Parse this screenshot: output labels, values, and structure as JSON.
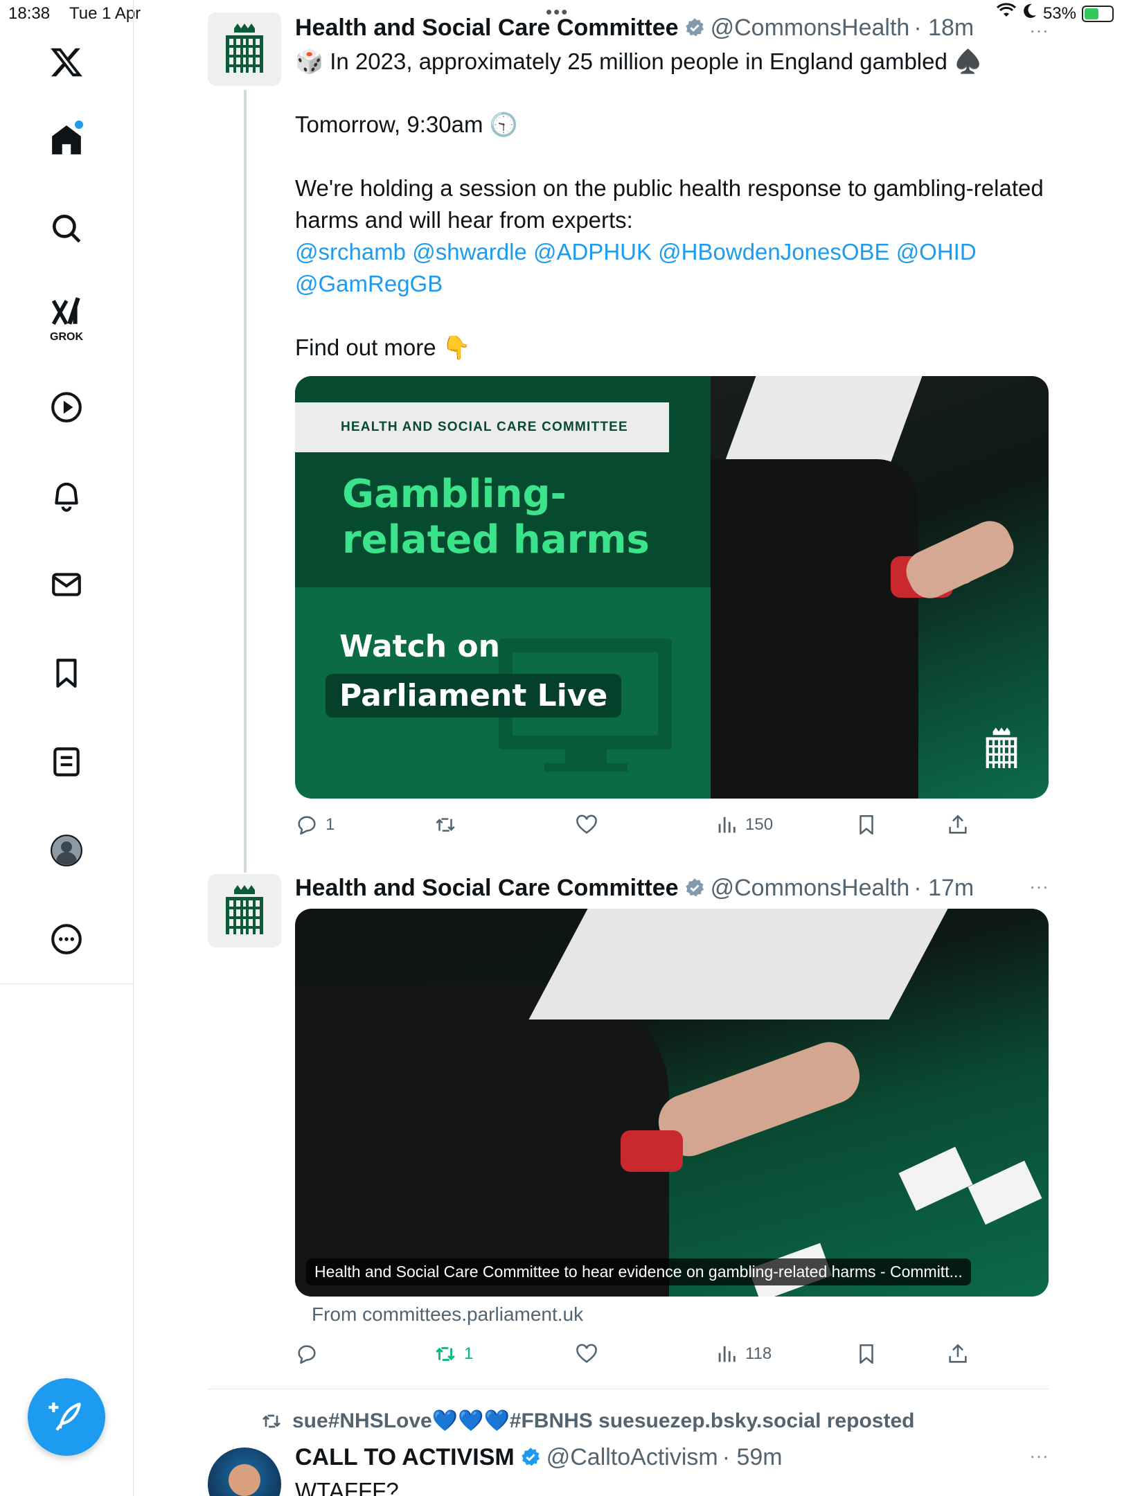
{
  "status_bar": {
    "time": "18:38",
    "date": "Tue 1 Apr",
    "battery": "53%",
    "battery_level": 0.53
  },
  "sidebar": {
    "logo": "x-logo-icon",
    "items": [
      {
        "name": "home",
        "icon": "home-icon"
      },
      {
        "name": "search",
        "icon": "search-icon"
      },
      {
        "name": "grok",
        "icon": "grok-icon",
        "label": "GROK"
      },
      {
        "name": "videos",
        "icon": "play-icon"
      },
      {
        "name": "notifications",
        "icon": "bell-icon"
      },
      {
        "name": "messages",
        "icon": "mail-icon"
      },
      {
        "name": "bookmarks",
        "icon": "bookmark-icon"
      },
      {
        "name": "lists",
        "icon": "list-icon"
      },
      {
        "name": "profile",
        "icon": "profile-icon"
      },
      {
        "name": "more",
        "icon": "more-icon"
      }
    ],
    "compose_icon": "compose-icon"
  },
  "tweets": [
    {
      "name": "Health and Social Care Committee",
      "handle": "@CommonsHealth",
      "time": "· 18m",
      "line1": "🎲 In 2023, approximately 25 million people in England gambled ♠️",
      "line2": "Tomorrow, 9:30am 🕤",
      "line3": "We're holding a session on the public health response to gambling-related harms and will hear from experts:",
      "mentions": [
        "@srchamb",
        "@shwardle",
        "@ADPHUK",
        "@HBowdenJonesOBE",
        "@OHID",
        "@GamRegGB"
      ],
      "line4": "Find out more 👇",
      "card": {
        "banner": "HEALTH AND SOCIAL CARE COMMITTEE",
        "headline1": "Gambling-",
        "headline2": "related harms",
        "watch1": "Watch on",
        "watch2": "Parliament Live"
      },
      "stats": {
        "replies": "1",
        "reposts": "",
        "likes": "",
        "views": "150"
      }
    },
    {
      "name": "Health and Social Care Committee",
      "handle": "@CommonsHealth",
      "time": "· 17m",
      "link_caption": "Health and Social Care Committee to hear evidence on gambling-related harms - Committ...",
      "link_source": "From committees.parliament.uk",
      "stats": {
        "replies": "",
        "reposts": "1",
        "likes": "",
        "views": "118"
      }
    },
    {
      "repost_by": "sue#NHSLove💙💙💙#FBNHS suesuezep.bsky.social reposted",
      "name": "CALL TO ACTIVISM",
      "handle": "@CalltoActivism",
      "time": "· 59m",
      "text": "WTAFFF?"
    }
  ]
}
